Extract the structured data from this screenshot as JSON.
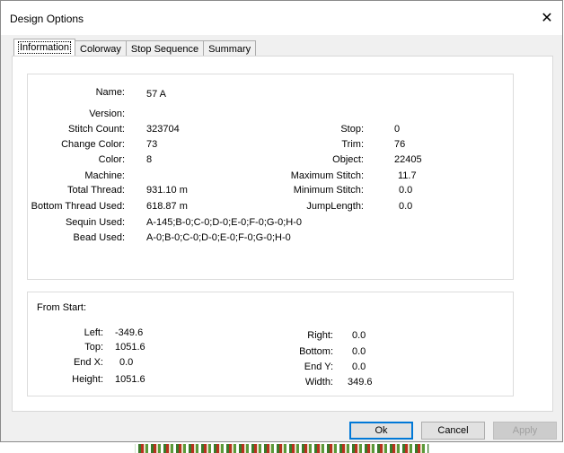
{
  "window": {
    "title": "Design Options"
  },
  "tabs": [
    "Information",
    "Colorway",
    "Stop Sequence",
    "Summary"
  ],
  "info": {
    "name_label": "Name:",
    "name": "57 A",
    "version_label": "Version:",
    "version": "",
    "stitch_count_label": "Stitch Count:",
    "stitch_count": "323704",
    "change_color_label": "Change Color:",
    "change_color": "73",
    "color_label": "Color:",
    "color": "8",
    "machine_label": "Machine:",
    "machine": "",
    "total_thread_label": "Total Thread:",
    "total_thread": "931.10 m",
    "bottom_thread_label": "Bottom Thread Used:",
    "bottom_thread": "618.87 m",
    "sequin_label": "Sequin Used:",
    "sequin": "A-145;B-0;C-0;D-0;E-0;F-0;G-0;H-0",
    "bead_label": "Bead Used:",
    "bead": "A-0;B-0;C-0;D-0;E-0;F-0;G-0;H-0",
    "stop_label": "Stop:",
    "stop": "0",
    "trim_label": "Trim:",
    "trim": "76",
    "object_label": "Object:",
    "object": "22405",
    "max_stitch_label": "Maximum Stitch:",
    "max_stitch": "11.7",
    "min_stitch_label": "Minimum Stitch:",
    "min_stitch": "0.0",
    "jump_label": "JumpLength:",
    "jump": "0.0"
  },
  "from_start": {
    "title": "From Start:",
    "left_label": "Left:",
    "left": "-349.6",
    "top_label": "Top:",
    "top": "1051.6",
    "endx_label": "End X:",
    "endx": "0.0",
    "height_label": "Height:",
    "height": "1051.6",
    "right_label": "Right:",
    "right": "0.0",
    "bottom_label": "Bottom:",
    "bottom": "0.0",
    "endy_label": "End Y:",
    "endy": "0.0",
    "width_label": "Width:",
    "width": "349.6"
  },
  "buttons": {
    "ok": "Ok",
    "cancel": "Cancel",
    "apply": "Apply"
  }
}
